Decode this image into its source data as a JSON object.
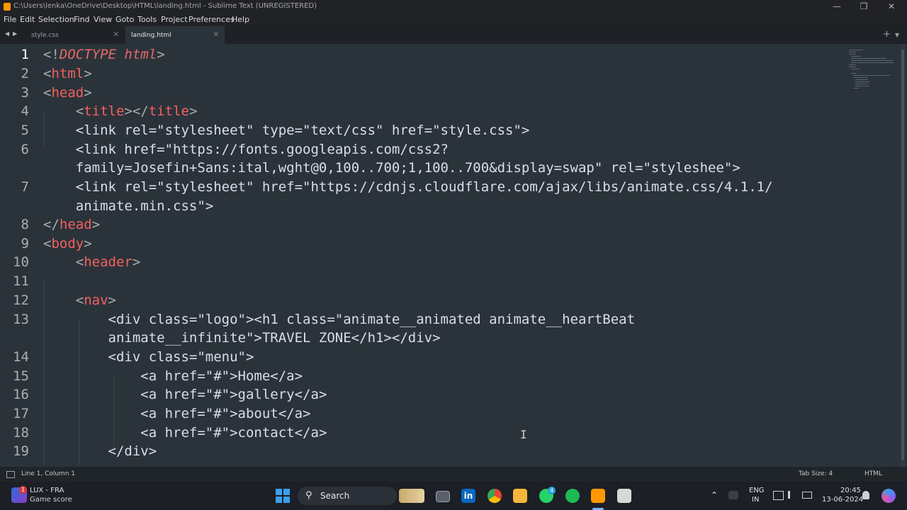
{
  "window": {
    "title": "C:\\Users\\lenka\\OneDrive\\Desktop\\HTML\\landing.html - Sublime Text (UNREGISTERED)",
    "minimize_glyph": "—",
    "maximize_glyph": "❐",
    "close_glyph": "✕"
  },
  "menu": [
    "File",
    "Edit",
    "Selection",
    "Find",
    "View",
    "Goto",
    "Tools",
    "Project",
    "Preferences",
    "Help"
  ],
  "tabs": [
    {
      "label": "style.css",
      "active": false
    },
    {
      "label": "landing.html",
      "active": true
    }
  ],
  "tab_close_glyph": "×",
  "tabbar_controls": {
    "back": "◀",
    "forward": "▶",
    "new_tab": "+",
    "dropdown": "▼"
  },
  "editor": {
    "current_line": 1,
    "line_numbers": [
      "1",
      "2",
      "3",
      "4",
      "5",
      "6",
      "7",
      "8",
      "9",
      "10",
      "11",
      "12",
      "13",
      "14",
      "15",
      "16",
      "17",
      "18",
      "19"
    ],
    "code": {
      "l1": {
        "open": "<!",
        "kw": "DOCTYPE",
        "sp": " ",
        "kw2": "html",
        "close": ">"
      },
      "l2": {
        "open": "<",
        "tag": "html",
        "close": ">"
      },
      "l3": {
        "open": "<",
        "tag": "head",
        "close": ">"
      },
      "l4": {
        "indent": "    ",
        "o1": "<",
        "t1": "title",
        "c1": "></",
        "t2": "title",
        "c2": ">"
      },
      "l5": {
        "indent": "    ",
        "text": "<link rel=\"stylesheet\" type=\"text/css\" href=\"style.css\">"
      },
      "l6a": {
        "indent": "    ",
        "text": "<link href=\"https://fonts.googleapis.com/css2?"
      },
      "l6b": {
        "indent": "    ",
        "text": "family=Josefin+Sans:ital,wght@0,100..700;1,100..700&display=swap\" rel=\"styleshee\">"
      },
      "l7a": {
        "indent": "    ",
        "text": "<link rel=\"stylesheet\" href=\"https://cdnjs.cloudflare.com/ajax/libs/animate.css/4.1.1/"
      },
      "l7b": {
        "indent": "    ",
        "text": "animate.min.css\">"
      },
      "l8": {
        "open": "</",
        "tag": "head",
        "close": ">"
      },
      "l9": {
        "open": "<",
        "tag": "body",
        "close": ">"
      },
      "l10": {
        "indent": "    ",
        "open": "<",
        "tag": "header",
        "close": ">"
      },
      "l12": {
        "indent": "    ",
        "open": "<",
        "tag": "nav",
        "close": ">"
      },
      "l13a": {
        "indent": "        ",
        "text": "<div class=\"logo\"><h1 class=\"animate__animated animate__heartBeat"
      },
      "l13b": {
        "indent": "        ",
        "text": "animate__infinite\">TRAVEL ZONE</h1></div>"
      },
      "l14": {
        "indent": "        ",
        "text": "<div class=\"menu\">"
      },
      "l15": {
        "indent": "            ",
        "text": "<a href=\"#\">Home</a>"
      },
      "l16": {
        "indent": "            ",
        "text": "<a href=\"#\">gallery</a>"
      },
      "l17": {
        "indent": "            ",
        "text": "<a href=\"#\">about</a>"
      },
      "l18": {
        "indent": "            ",
        "text": "<a href=\"#\">contact</a>"
      },
      "l19": {
        "indent": "        ",
        "text": "</div>"
      }
    },
    "mouse_cursor_glyph": "I"
  },
  "status": {
    "position": "Line 1, Column 1",
    "tab_size": "Tab Size: 4",
    "syntax": "HTML"
  },
  "taskbar": {
    "game_badge": "1",
    "game_title": "LUX - FRA",
    "game_subtitle": "Game score",
    "search_label": "Search",
    "whatsapp_badge": "4",
    "language": "ENG",
    "region": "IN",
    "time": "20:45",
    "date": "13-06-2024",
    "tray_chevron": "⌃"
  }
}
